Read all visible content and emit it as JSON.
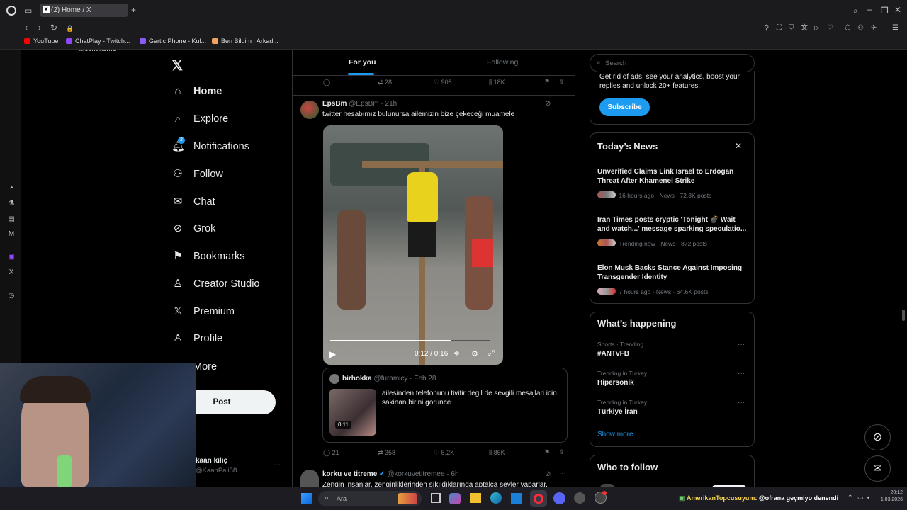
{
  "browser": {
    "tab_title": "(2) Home / X",
    "url": "x.com/home",
    "ai_label": "AI",
    "bookmarks": [
      {
        "label": "YouTube",
        "color": "#ff0000"
      },
      {
        "label": "ChatPlay - Twitch...",
        "color": "#9146ff"
      },
      {
        "label": "Gartic Phone - Kul...",
        "color": "#8a5cf6"
      },
      {
        "label": "Ben Bildim | Arkad...",
        "color": "#f4a261"
      }
    ]
  },
  "sidebar": {
    "items": [
      {
        "label": "Home",
        "icon": "home-icon"
      },
      {
        "label": "Explore",
        "icon": "search-icon"
      },
      {
        "label": "Notifications",
        "icon": "bell-icon",
        "badge": "2"
      },
      {
        "label": "Follow",
        "icon": "follow-icon"
      },
      {
        "label": "Chat",
        "icon": "mail-icon"
      },
      {
        "label": "Grok",
        "icon": "grok-icon"
      },
      {
        "label": "Bookmarks",
        "icon": "bookmark-icon"
      },
      {
        "label": "Creator Studio",
        "icon": "creator-icon"
      },
      {
        "label": "Premium",
        "icon": "x-icon"
      },
      {
        "label": "Profile",
        "icon": "person-icon"
      },
      {
        "label": "More",
        "icon": "more-icon"
      }
    ],
    "post_label": "Post",
    "account_name": "kaan kılıç",
    "account_handle": "@KaanPali58"
  },
  "feed": {
    "tabs": [
      "For you",
      "Following"
    ],
    "prev_stats": {
      "reposts": "28",
      "likes": "908",
      "views": "18K"
    },
    "tweet": {
      "name": "EpsBm",
      "handle": "@EpsBm · 21h",
      "text": "twitter hesabımız bulunursa ailemizin bize çekeceği muamele",
      "video_time": "0:12 / 0:16",
      "progress": 0.75,
      "quote": {
        "name": "birhokka",
        "handle": "@furamicy · Feb 28",
        "text": "ailesinden telefonunu tivitir degil de sevgili mesajlari icin sakinan birini gorunce",
        "duration": "0:11"
      },
      "stats": {
        "replies": "21",
        "reposts": "358",
        "likes": "5.2K",
        "views": "86K"
      }
    },
    "next": {
      "name": "korku ve titreme",
      "handle": "@korkuvetitremee · 6h",
      "text": "Zengin insanlar, zenginliklerinden sıkıldıklarında aptalca şeyler yaparlar."
    }
  },
  "right": {
    "search_placeholder": "Search",
    "premium_text": "Get rid of ads, see your analytics, boost your replies and unlock 20+ features.",
    "subscribe_label": "Subscribe",
    "news_title": "Today’s News",
    "news": [
      {
        "title": "Unverified Claims Link Israel to Erdogan Threat After Khamenei Strike",
        "meta": "16 hours ago · News · 72.3K posts"
      },
      {
        "title": "Iran Times posts cryptic 'Tonight 💣 Wait and watch...' message sparking speculatio...",
        "meta": "Trending now · News · 872 posts"
      },
      {
        "title": "Elon Musk Backs Stance Against Imposing Transgender Identity",
        "meta": "7 hours ago · News · 64.6K posts"
      }
    ],
    "happening_title": "What’s happening",
    "trends": [
      {
        "context": "Sports · Trending",
        "name": "#ANTvFB"
      },
      {
        "context": "Trending in Turkey",
        "name": "Hipersonik"
      },
      {
        "context": "Trending in Turkey",
        "name": "Türkiye İran"
      }
    ],
    "show_more": "Show more",
    "who_to_follow": "Who to follow"
  },
  "taskbar": {
    "search_label": "Ara",
    "stream_user": "AmerikanTopcusuyum",
    "stream_msg": ": @ofrana geçmiyo denendi",
    "time": "20:12",
    "date": "1.03.2026"
  }
}
